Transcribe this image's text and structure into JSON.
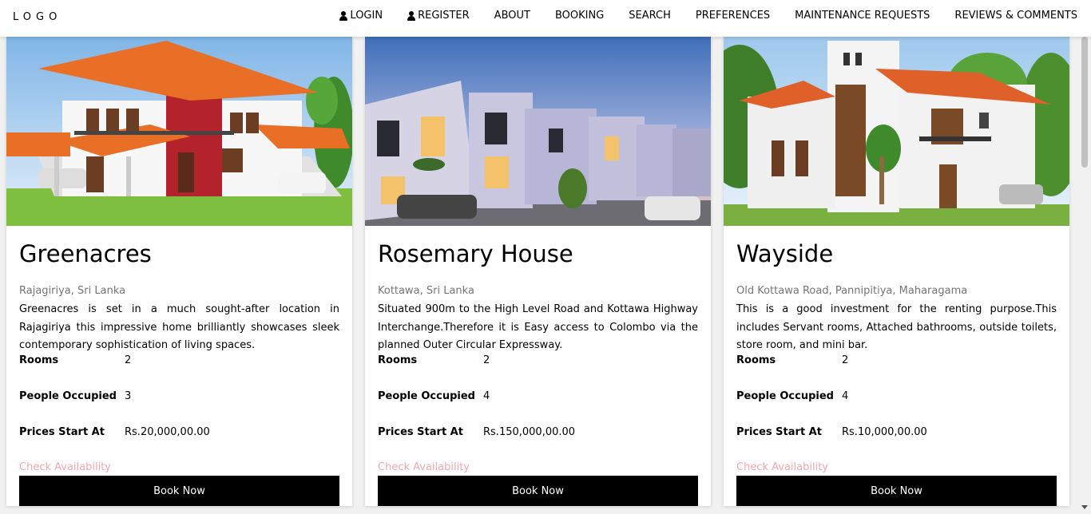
{
  "nav": {
    "logo": "LOGO",
    "items": [
      {
        "label": "LOGIN",
        "icon": "user-icon"
      },
      {
        "label": "REGISTER",
        "icon": "user-icon"
      },
      {
        "label": "ABOUT"
      },
      {
        "label": "BOOKING"
      },
      {
        "label": "SEARCH"
      },
      {
        "label": "PREFERENCES"
      },
      {
        "label": "MAINTENANCE REQUESTS"
      },
      {
        "label": "REVIEWS & COMMENTS"
      }
    ]
  },
  "labels": {
    "rooms": "Rooms",
    "people": "People Occupied",
    "price": "Prices Start At",
    "check": "Check Availability",
    "book": "Book Now"
  },
  "cards": [
    {
      "title": "Greenacres",
      "location": "Rajagiriya, Sri Lanka",
      "description": "Greenacres is set in a much sought-after location in Rajagiriya this impressive home brilliantly showcases sleek contemporary sophistication of living spaces.",
      "rooms": "2",
      "people": "3",
      "price": "Rs.20,000,00.00"
    },
    {
      "title": "Rosemary House",
      "location": "Kottawa, Sri Lanka",
      "description": "Situated 900m to the High Level Road and Kottawa Highway Interchange.Therefore it is Easy access to Colombo via the planned Outer Circular Expressway.",
      "rooms": "2",
      "people": "4",
      "price": "Rs.150,000,00.00"
    },
    {
      "title": "Wayside",
      "location": "Old Kottawa Road, Pannipitiya, Maharagama",
      "description": "This is a good investment for the renting purpose.This includes Servant rooms, Attached bathrooms, outside toilets, store room, and mini bar.",
      "rooms": "2",
      "people": "4",
      "price": "Rs.10,000,00.00"
    }
  ],
  "colors": {
    "accent_link": "#f5a6b0",
    "button": "#000000"
  }
}
